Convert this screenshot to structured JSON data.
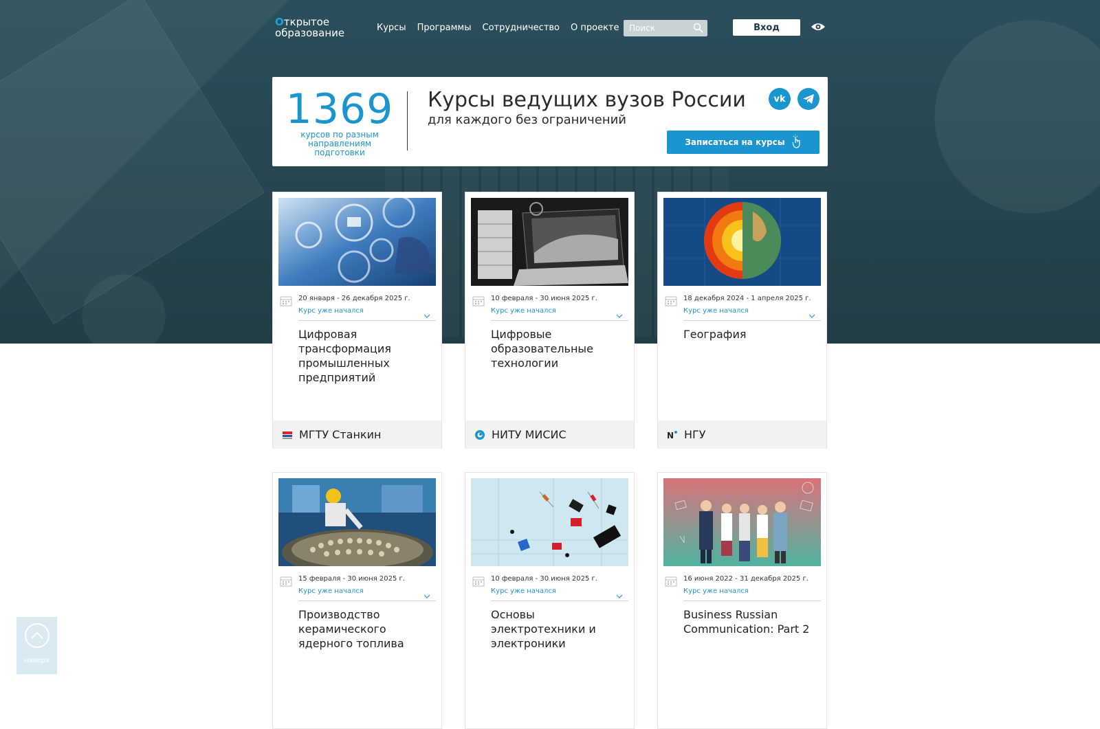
{
  "header": {
    "logo_line1": "ткрытое",
    "logo_o": "О",
    "logo_line2": "образование",
    "nav": [
      "Курсы",
      "Программы",
      "Сотрудничество",
      "О проекте"
    ],
    "search_placeholder": "Поиск",
    "login_label": "Вход"
  },
  "banner": {
    "count": "1369",
    "count_sub": "курсов по разным направлениям подготовки",
    "title": "Курсы ведущих вузов России",
    "subtitle": "для каждого без ограничений",
    "vk_label": "vk",
    "enroll_label": "Записаться на курсы"
  },
  "cards": [
    {
      "date": "20 января - 26 декабря 2025 г.",
      "status": "Курс уже начался",
      "title": "Цифровая трансформация промышленных предприятий",
      "univ": "МГТУ Станкин"
    },
    {
      "date": "10 февраля - 30 июня 2025 г.",
      "status": "Курс уже начался",
      "title": "Цифровые образовательные технологии",
      "univ": "НИТУ МИСИС"
    },
    {
      "date": "18 декабря 2024 - 1 апреля 2025 г.",
      "status": "Курс уже начался",
      "title": "География",
      "univ": "НГУ"
    },
    {
      "date": "15 февраля - 30 июня 2025 г.",
      "status": "Курс уже начался",
      "title": "Производство керамического ядерного топлива"
    },
    {
      "date": "10 февраля - 30 июня 2025 г.",
      "status": "Курс уже начался",
      "title": "Основы электротехники и электроники"
    },
    {
      "date": "16 июня 2022 - 31 декабря 2025 г.",
      "status": "Курс уже начался",
      "title": "Business Russian Communication: Part 2"
    }
  ],
  "scroll_top_label": "наверх",
  "colors": {
    "accent": "#1b95cf",
    "hero": "#26454f"
  }
}
